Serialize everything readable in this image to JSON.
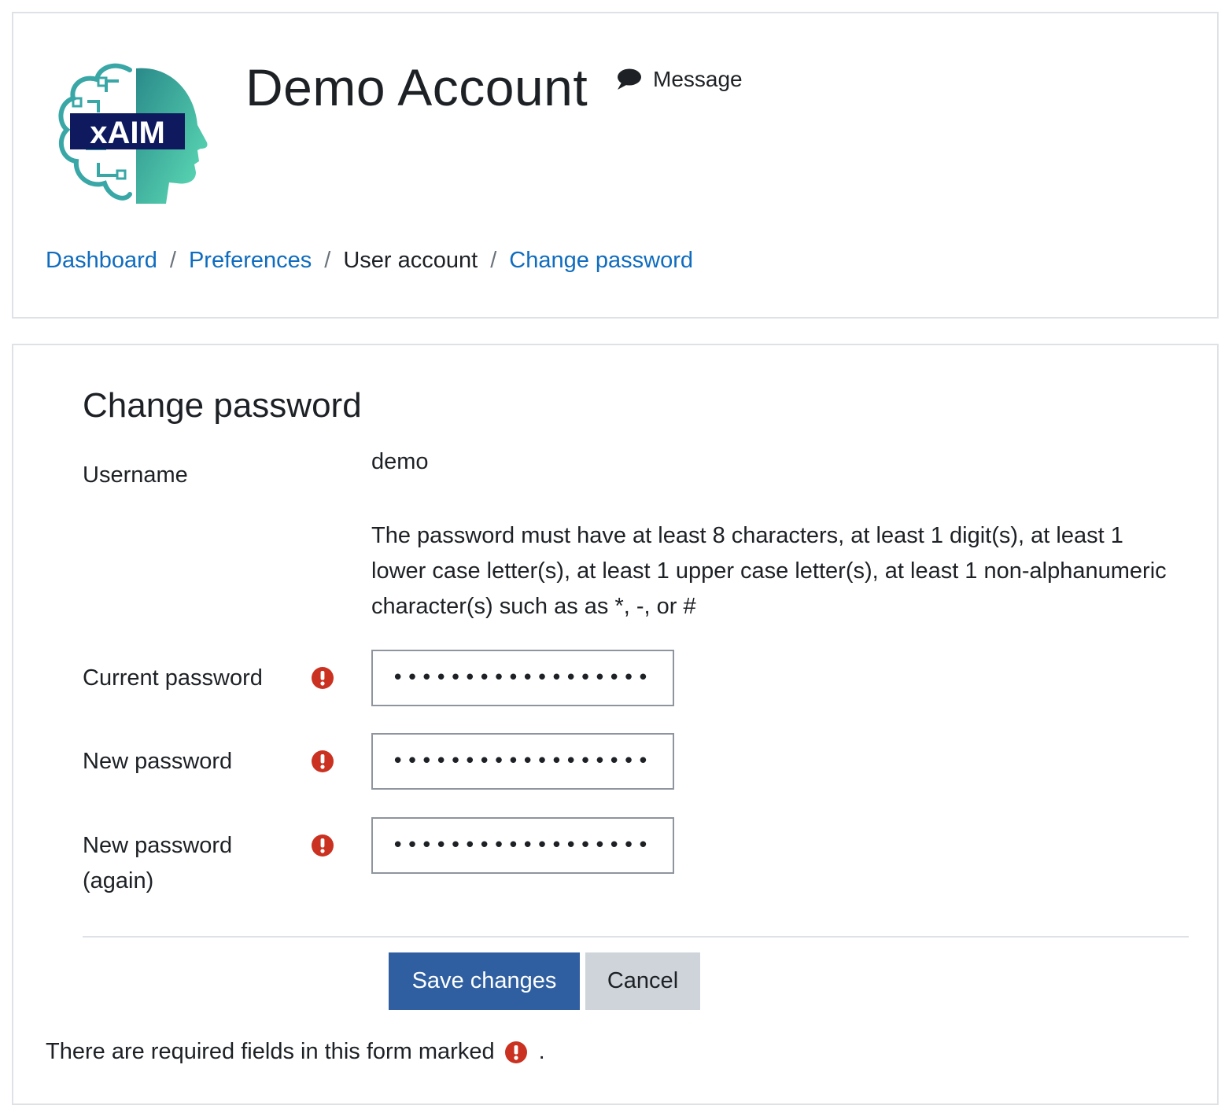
{
  "header": {
    "logo": {
      "icon": "xaim-logo",
      "text": "xAIM"
    },
    "heading": "Demo Account",
    "message_link": {
      "icon": "speech-bubble-icon",
      "label": "Message"
    }
  },
  "breadcrumb": {
    "items": [
      {
        "label": "Dashboard",
        "link": true
      },
      {
        "label": "Preferences",
        "link": true
      },
      {
        "label": "User account",
        "link": false
      },
      {
        "label": "Change password",
        "link": true
      }
    ],
    "separator": "/"
  },
  "form": {
    "title": "Change password",
    "username_label": "Username",
    "username_value": "demo",
    "policy": "The password must have at least 8 characters, at least 1 digit(s), at least 1 lower case letter(s), at least 1 upper case letter(s), at least 1 non-alphanumeric character(s) such as as *, -, or #",
    "fields": [
      {
        "label": "Current password",
        "value": "••••••••••••••••••",
        "required": true
      },
      {
        "label": "New password",
        "value": "••••••••••••••••••",
        "required": true
      },
      {
        "label_line1": "New password",
        "label_line2": "(again)",
        "value": "••••••••••••••••••",
        "required": true
      }
    ],
    "required_icon": "exclamation-circle-icon",
    "save_label": "Save changes",
    "cancel_label": "Cancel",
    "required_note_prefix": "There are required fields in this form marked",
    "required_note_suffix": "."
  },
  "colors": {
    "link": "#0f6cbf",
    "primary_button": "#2f5fa0",
    "secondary_button": "#ced4da",
    "required_icon": "#ca3120",
    "logo_navy": "#0f1a5e",
    "logo_teal": "#4fd1b0"
  }
}
